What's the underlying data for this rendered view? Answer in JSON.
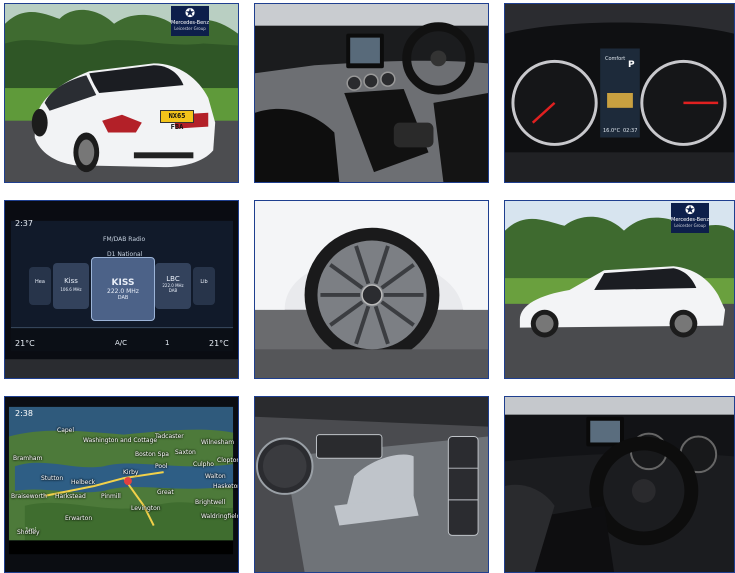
{
  "badge": {
    "star": "✪",
    "line1": "Mercedes-Benz",
    "line2": "Leicester Group"
  },
  "tile_rear": {
    "plate": "NX65 FBA"
  },
  "tile_cluster": {
    "drive_mode": "Comfort",
    "temp": "16.0°C",
    "time": "02:37",
    "gear": "P"
  },
  "tile_radio": {
    "time": "2:37",
    "header": "FM/DAB Radio",
    "station_top": "D1 National",
    "stations": [
      {
        "name": "Hea",
        "sub": ""
      },
      {
        "name": "Kiss",
        "sub": "106.6 MHz"
      },
      {
        "name": "KISS",
        "sub": "222.0 MHz",
        "sub2": "DAB"
      },
      {
        "name": "LBC",
        "sub": "222.0 MHz",
        "sub2": "DAB"
      },
      {
        "name": "Lib",
        "sub": ""
      }
    ],
    "temp_left": "21°C",
    "ac": "A/C",
    "fan": "1",
    "temp_right": "21°C"
  },
  "tile_map": {
    "time": "2:38",
    "scale": "1mi",
    "places": [
      "Capel",
      "Washington and Cottage",
      "Bramham",
      "Stutton",
      "Tadcaster",
      "Wilnesham",
      "Saxton",
      "Boston Spa",
      "Helbeck",
      "Culpho",
      "Clopton",
      "Walton",
      "Hasketon",
      "Kirby",
      "Pool",
      "Great",
      "Brightwell",
      "Levington",
      "Waldringfield",
      "Erwarton",
      "Harkstead",
      "Pinmill",
      "Braiseworth",
      "Shotley"
    ]
  }
}
